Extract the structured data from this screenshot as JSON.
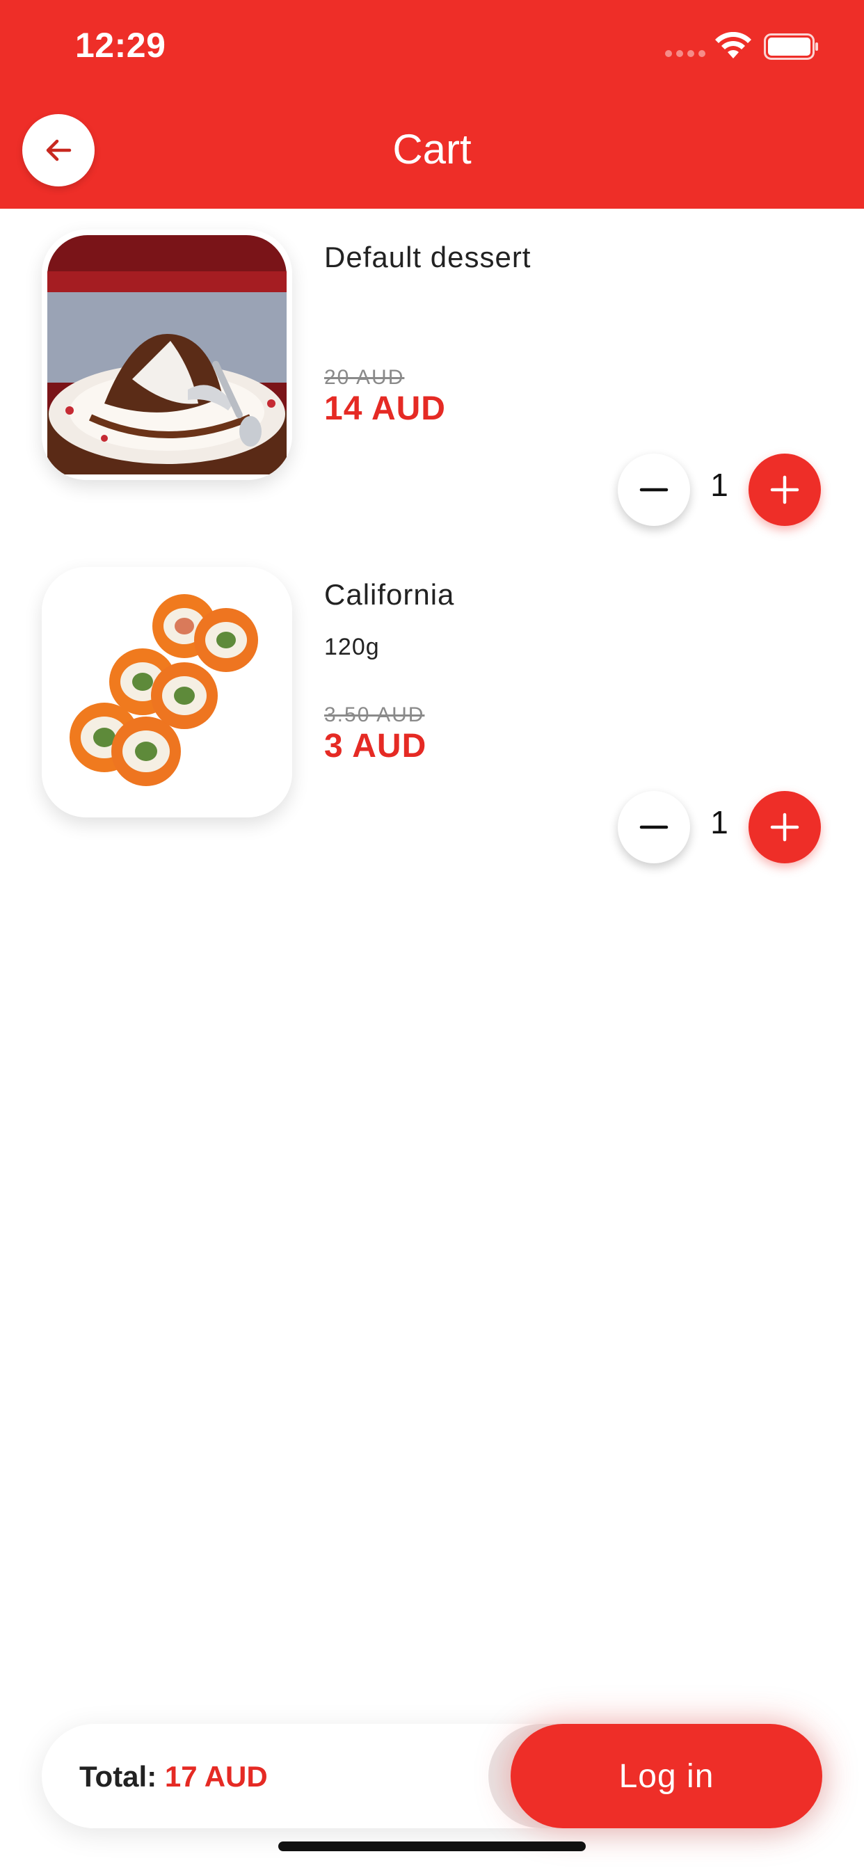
{
  "status_bar": {
    "time": "12:29"
  },
  "header": {
    "title": "Cart",
    "back_icon": "arrow-left-icon"
  },
  "cart": {
    "items": [
      {
        "name": "Default dessert",
        "weight": "",
        "old_price": "20 AUD",
        "price": "14 AUD",
        "quantity": "1",
        "image": "chocolate-lava-cake"
      },
      {
        "name": "California",
        "weight": "120g",
        "old_price": "3.50 AUD",
        "price": "3 AUD",
        "quantity": "1",
        "image": "california-roll-sushi"
      }
    ]
  },
  "footer": {
    "total_label": "Total:",
    "total_value": "17 AUD",
    "login_label": "Log in"
  },
  "colors": {
    "accent": "#ee2e28",
    "price": "#e52a24",
    "text": "#222222",
    "muted": "#8a8a8a"
  }
}
